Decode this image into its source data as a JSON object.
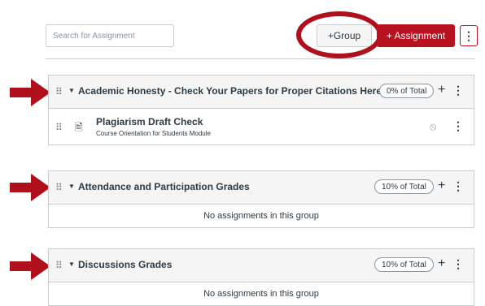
{
  "toolbar": {
    "search_placeholder": "Search for Assignment",
    "group_label": "+Group",
    "assignment_label": "+ Assignment",
    "menu_glyph": "⋮"
  },
  "groups": [
    {
      "title": "Academic Honesty - Check Your Papers for Proper Citations Here",
      "weight": "0% of Total",
      "assignments": [
        {
          "title": "Plagiarism Draft Check",
          "module": "Course Orientation for Students Module"
        }
      ]
    },
    {
      "title": "Attendance and Participation Grades",
      "weight": "10% of Total",
      "empty_text": "No assignments in this group"
    },
    {
      "title": "Discussions Grades",
      "weight": "10% of Total",
      "empty_text": "No assignments in this group"
    }
  ],
  "glyphs": {
    "plus": "+",
    "kebab": "⋮",
    "caret": "▼",
    "drag": "⠿",
    "ban": "⦸",
    "doc": "🖹"
  },
  "colors": {
    "accent": "#b8111f",
    "header_bg": "#f5f5f5",
    "border": "#c7cdd1",
    "annotation": "#b0101b"
  }
}
